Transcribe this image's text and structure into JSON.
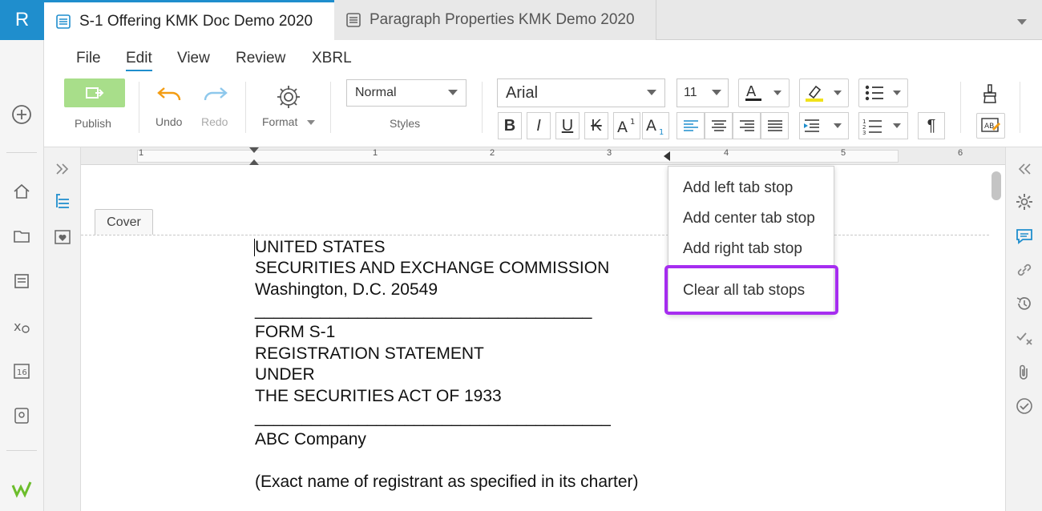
{
  "app": {
    "logo_letter": "R"
  },
  "tabs": [
    {
      "label": "S-1 Offering KMK Doc Demo 2020",
      "active": true
    },
    {
      "label": "Paragraph Properties KMK Demo 2020",
      "active": false
    }
  ],
  "menu": [
    "File",
    "Edit",
    "View",
    "Review",
    "XBRL"
  ],
  "toolbar": {
    "publish_label": "Publish",
    "undo_label": "Undo",
    "redo_label": "Redo",
    "format_label": "Format",
    "styles_value": "Normal",
    "styles_label": "Styles",
    "font_value": "Arial",
    "size_value": "11",
    "color_accent": "#1f8ecd",
    "publish_color": "#a8de8a"
  },
  "ruler_numbers": [
    "1",
    "1",
    "2",
    "3",
    "4",
    "5",
    "6"
  ],
  "cover_tab": "Cover",
  "document_lines": [
    "UNITED STATES",
    "SECURITIES AND EXCHANGE COMMISSION",
    "Washington, D.C. 20549",
    "____________________________________",
    "FORM S-1",
    "REGISTRATION STATEMENT",
    "UNDER",
    "THE SECURITIES ACT OF 1933",
    "______________________________________",
    "ABC Company",
    "",
    "(Exact name of registrant as specified in its charter)"
  ],
  "context_menu": {
    "items": [
      "Add left tab stop",
      "Add center tab stop",
      "Add right tab stop",
      "Clear all tab stops"
    ],
    "highlight_color": "#a62df0"
  }
}
